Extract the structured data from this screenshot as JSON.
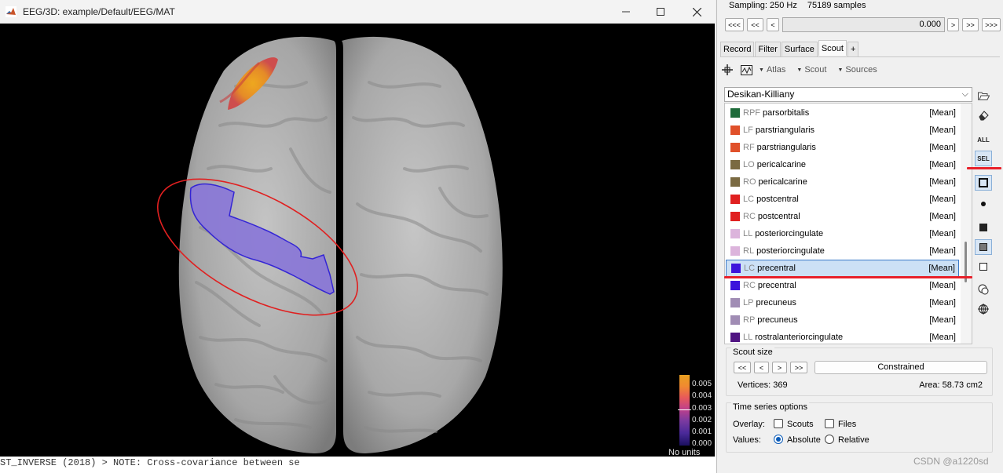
{
  "figure_window": {
    "title": "EEG/3D: example/Default/EEG/MAT",
    "min_icon": "minimize-icon",
    "max_icon": "maximize-icon",
    "close_icon": "close-icon"
  },
  "colorbar": {
    "ticks": [
      "0.005",
      "0.004",
      "0.003",
      "0.002",
      "0.001",
      "0.000"
    ],
    "units": "No units"
  },
  "console": {
    "text": "ST_INVERSE (2018) > NOTE: Cross-covariance between se"
  },
  "panel": {
    "sampling_label": "Sampling: 250 Hz",
    "samples_label": "75189 samples",
    "nav_back": [
      "<<<",
      "<<",
      "<"
    ],
    "nav_fwd": [
      ">",
      ">>",
      ">>>"
    ],
    "time_value": "0.000",
    "tabs": [
      "Record",
      "Filter",
      "Surface",
      "Scout",
      "+"
    ],
    "active_tab": "Scout",
    "toolbar": {
      "atlas_menu": "Atlas",
      "scout_menu": "Scout",
      "sources_menu": "Sources"
    },
    "atlas": "Desikan-Killiany",
    "scouts": [
      {
        "prefix": "RPF",
        "name": "parsorbitalis",
        "fn": "[Mean]",
        "color": "#1e6b3a",
        "selected": false
      },
      {
        "prefix": "LF",
        "name": "parstriangularis",
        "fn": "[Mean]",
        "color": "#e0502a",
        "selected": false
      },
      {
        "prefix": "RF",
        "name": "parstriangularis",
        "fn": "[Mean]",
        "color": "#e0502a",
        "selected": false
      },
      {
        "prefix": "LO",
        "name": "pericalcarine",
        "fn": "[Mean]",
        "color": "#7a6a42",
        "selected": false
      },
      {
        "prefix": "RO",
        "name": "pericalcarine",
        "fn": "[Mean]",
        "color": "#7a6a42",
        "selected": false
      },
      {
        "prefix": "LC",
        "name": "postcentral",
        "fn": "[Mean]",
        "color": "#e02020",
        "selected": false
      },
      {
        "prefix": "RC",
        "name": "postcentral",
        "fn": "[Mean]",
        "color": "#e02020",
        "selected": false
      },
      {
        "prefix": "LL",
        "name": "posteriorcingulate",
        "fn": "[Mean]",
        "color": "#dcb4dc",
        "selected": false
      },
      {
        "prefix": "RL",
        "name": "posteriorcingulate",
        "fn": "[Mean]",
        "color": "#dcb4dc",
        "selected": false
      },
      {
        "prefix": "LC",
        "name": "precentral",
        "fn": "[Mean]",
        "color": "#3c14dc",
        "selected": true
      },
      {
        "prefix": "RC",
        "name": "precentral",
        "fn": "[Mean]",
        "color": "#3c14dc",
        "selected": false
      },
      {
        "prefix": "LP",
        "name": "precuneus",
        "fn": "[Mean]",
        "color": "#a08cb4",
        "selected": false
      },
      {
        "prefix": "RP",
        "name": "precuneus",
        "fn": "[Mean]",
        "color": "#a08cb4",
        "selected": false
      },
      {
        "prefix": "LL",
        "name": "rostralanteriorcingulate",
        "fn": "[Mean]",
        "color": "#501482",
        "selected": false
      }
    ],
    "side_buttons": {
      "all_label": "ALL",
      "sel_label": "SEL"
    },
    "scout_size": {
      "title": "Scout size",
      "buttons": [
        "<<",
        "<",
        ">",
        ">>"
      ],
      "constrained_label": "Constrained",
      "vertices_label": "Vertices: 369",
      "area_label": "Area: 58.73 cm2"
    },
    "time_series": {
      "title": "Time series options",
      "overlay_label": "Overlay:",
      "scouts_label": "Scouts",
      "files_label": "Files",
      "values_label": "Values:",
      "absolute_label": "Absolute",
      "relative_label": "Relative",
      "selected_value": "Absolute"
    }
  },
  "watermark": "CSDN @a1220sd"
}
